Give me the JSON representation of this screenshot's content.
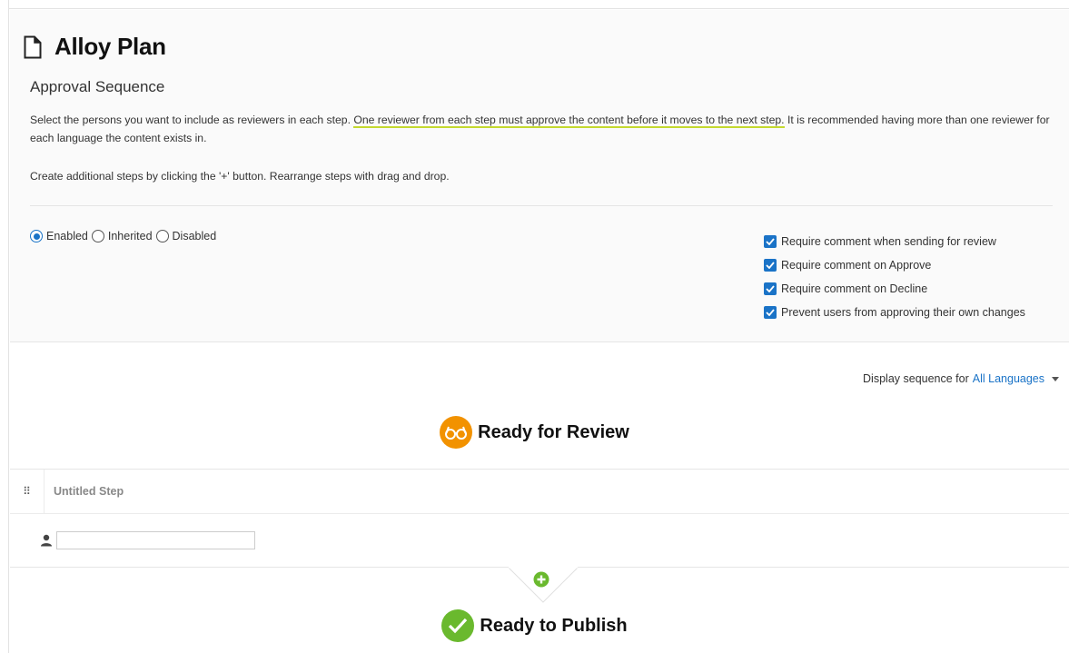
{
  "page": {
    "title": "Alloy Plan",
    "subtitle": "Approval Sequence",
    "description_part1": "Select the persons you want to include as reviewers in each step. ",
    "description_highlight": "One reviewer from each step must approve the content before it moves to the next step.",
    "description_part2": " It is recommended having more than one reviewer for each language the content exists in.",
    "hint": "Create additional steps by clicking the '+' button. Rearrange steps with drag and drop."
  },
  "status_options": [
    {
      "label": "Enabled",
      "selected": true
    },
    {
      "label": "Inherited",
      "selected": false
    },
    {
      "label": "Disabled",
      "selected": false
    }
  ],
  "settings": [
    {
      "label": "Require comment when sending for review",
      "checked": true
    },
    {
      "label": "Require comment on Approve",
      "checked": true
    },
    {
      "label": "Require comment on Decline",
      "checked": true
    },
    {
      "label": "Prevent users from approving their own changes",
      "checked": true
    }
  ],
  "display_sequence": {
    "label": "Display sequence for",
    "value": "All Languages"
  },
  "stages": {
    "review_title": "Ready for Review",
    "publish_title": "Ready to Publish"
  },
  "step": {
    "name": "Untitled Step",
    "reviewer_value": "",
    "grip_glyph": "⠿"
  },
  "colors": {
    "accent_blue": "#1a73c7",
    "review_orange": "#f29200",
    "publish_green": "#6ab92e",
    "highlight_underline": "#c4d92e"
  }
}
